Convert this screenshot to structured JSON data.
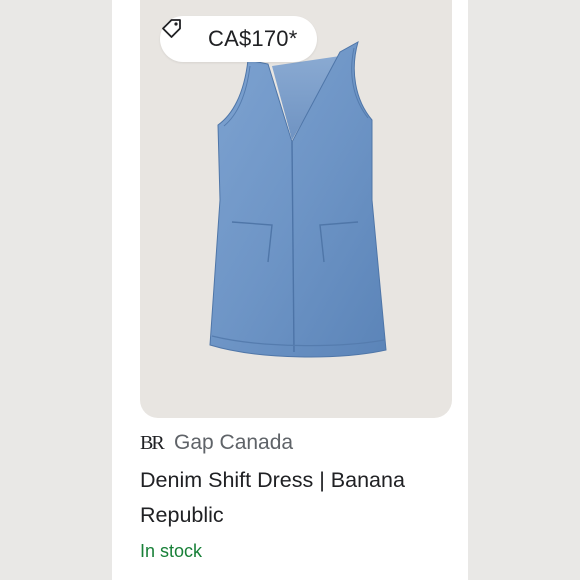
{
  "product": {
    "price": "CA$170*",
    "merchant_logo": "BR",
    "merchant": "Gap Canada",
    "title": "Denim Shift Dress | Banana Republic",
    "availability": "In stock"
  },
  "colors": {
    "availability": "#188038",
    "denim": "#6e95c6",
    "image_background": "#e8e5e1"
  },
  "icons": {
    "price": "price-tag-icon"
  }
}
